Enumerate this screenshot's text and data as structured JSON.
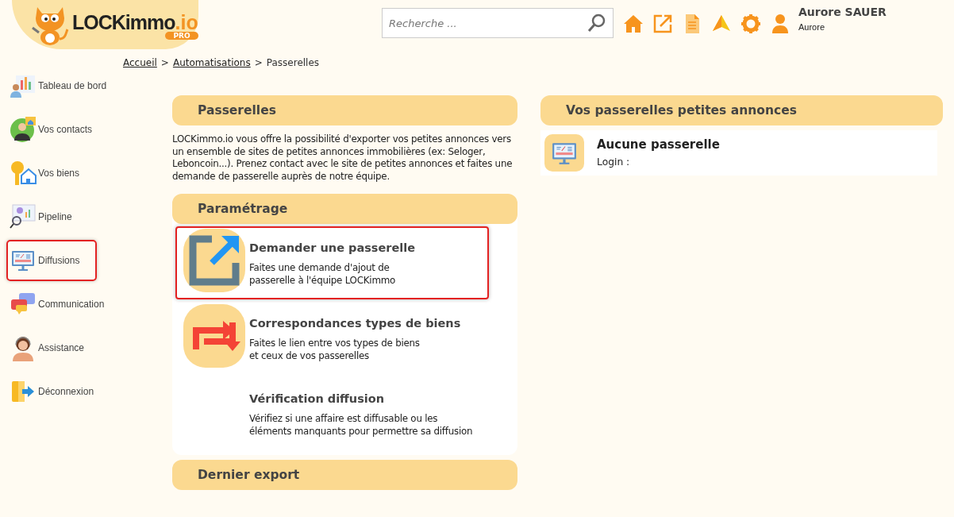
{
  "logo": {
    "name": "LOCKimmo",
    "suffix": ".io",
    "badge": "PRO"
  },
  "search": {
    "placeholder": "Recherche ..."
  },
  "user": {
    "name": "Aurore SAUER",
    "login": "Aurore"
  },
  "breadcrumb": [
    {
      "label": "Accueil",
      "link": true
    },
    {
      "label": ">",
      "link": false
    },
    {
      "label": "Automatisations",
      "link": true
    },
    {
      "label": ">",
      "link": false
    },
    {
      "label": "Passerelles",
      "link": false
    }
  ],
  "sidebar": {
    "items": [
      {
        "label": "Tableau de bord",
        "selected": false
      },
      {
        "label": "Vos contacts",
        "selected": false
      },
      {
        "label": "Vos biens",
        "selected": false
      },
      {
        "label": "Pipeline",
        "selected": false
      },
      {
        "label": "Diffusions",
        "selected": true
      },
      {
        "label": "Communication",
        "selected": false
      },
      {
        "label": "Assistance",
        "selected": false
      },
      {
        "label": "Déconnexion",
        "selected": false
      }
    ]
  },
  "passerelles": {
    "title": "Passerelles",
    "text": "LOCKimmo.io vous offre la possibilité d'exporter vos petites annonces vers un ensemble de sites de petites annonces immobilières (ex: Seloger, Leboncoin...). Prenez contact avec le site de petites annonces et faites une demande de passerelle auprès de notre équipe."
  },
  "parametrage": {
    "title": "Paramétrage",
    "items": [
      {
        "kind": "external",
        "title": "Demander une passerelle",
        "lines": [
          "Faites une demande d'ajout de",
          "passerelle à l'équipe LOCKimmo"
        ],
        "selected": true
      },
      {
        "kind": "repeat",
        "title": "Correspondances types de biens",
        "lines": [
          "Faites le lien entre vos types de biens",
          "et ceux de vos passerelles"
        ],
        "selected": false
      },
      {
        "kind": "none",
        "title": "Vérification diffusion",
        "lines": [
          "Vérifiez si une affaire est diffusable ou les",
          "éléments manquants pour permettre sa diffusion"
        ],
        "selected": false
      }
    ]
  },
  "dernier_export": {
    "title": "Dernier export"
  },
  "vos_passerelles": {
    "title": "Vos passerelles petites annonces",
    "entry": {
      "title": "Aucune passerelle",
      "login": "Login :"
    }
  }
}
